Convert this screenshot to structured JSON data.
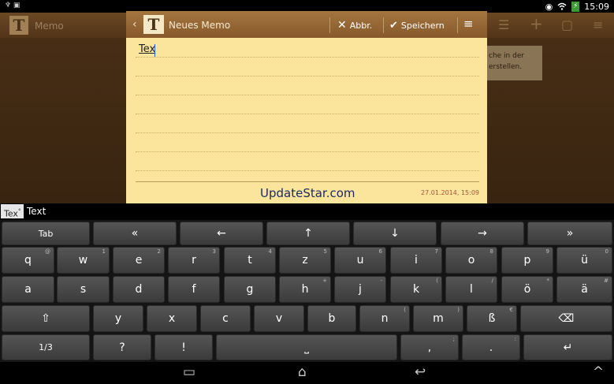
{
  "statusbar": {
    "left_icons": "♆ ▣",
    "eye": "◉",
    "wifi": "wifi",
    "battery": "⚡",
    "time": "15:09"
  },
  "bg": {
    "logo": "T",
    "title": "Memo",
    "hint_line1": "che in der",
    "hint_line2": "erstellen.",
    "icons": [
      "list-icon",
      "add-icon",
      "trash-icon",
      "menu-icon"
    ],
    "glyphs": {
      "list": "☰",
      "add": "+",
      "trash": "▢",
      "menu": "≡"
    }
  },
  "memo": {
    "back": "‹",
    "logo": "T",
    "title": "Neues Memo",
    "cancel_icon": "✕",
    "cancel": "Abbr.",
    "save_icon": "✔",
    "save": "Speichern",
    "menu_icon": "≡",
    "text": "Tex",
    "brand": "UpdateStar.com",
    "date": "27.01.2014,  15:09"
  },
  "suggestions": {
    "typed": "Tex",
    "suggestion": "Text",
    "typed_mark": "°"
  },
  "keyboard": {
    "row0": [
      {
        "l": "Tab"
      },
      {
        "l": "«"
      },
      {
        "l": "←"
      },
      {
        "l": "↑"
      },
      {
        "l": "↓"
      },
      {
        "l": "→"
      },
      {
        "l": "»"
      }
    ],
    "row1": [
      {
        "l": "q",
        "s": "@"
      },
      {
        "l": "w",
        "s": "1"
      },
      {
        "l": "e",
        "s": "2"
      },
      {
        "l": "r",
        "s": "3"
      },
      {
        "l": "t",
        "s": "4"
      },
      {
        "l": "z",
        "s": "5"
      },
      {
        "l": "u",
        "s": "6"
      },
      {
        "l": "i",
        "s": "7"
      },
      {
        "l": "o",
        "s": "8"
      },
      {
        "l": "p",
        "s": "9"
      },
      {
        "l": "ü",
        "s": "0"
      }
    ],
    "row2": [
      {
        "l": "a"
      },
      {
        "l": "s"
      },
      {
        "l": "d"
      },
      {
        "l": "f"
      },
      {
        "l": "g"
      },
      {
        "l": "h",
        "s": "+"
      },
      {
        "l": "j",
        "s": "-"
      },
      {
        "l": "k",
        "s": "("
      },
      {
        "l": "l",
        "s": "/"
      },
      {
        "l": "ö",
        "s": "*"
      },
      {
        "l": "ä",
        "s": "#"
      }
    ],
    "row3": [
      {
        "l": "⇧"
      },
      {
        "l": "y"
      },
      {
        "l": "x"
      },
      {
        "l": "c"
      },
      {
        "l": "v"
      },
      {
        "l": "b"
      },
      {
        "l": "n",
        "s": "("
      },
      {
        "l": "m",
        "s": ")"
      },
      {
        "l": "ß",
        "s": "€"
      },
      {
        "l": "⌫"
      }
    ],
    "row4": [
      {
        "l": "1/3"
      },
      {
        "l": "?"
      },
      {
        "l": "!"
      },
      {
        "l": "⎵"
      },
      {
        "l": ",",
        "s": ";"
      },
      {
        "l": ".",
        "s": ":"
      },
      {
        "l": "↵"
      }
    ]
  },
  "navbar": {
    "recent": "▭",
    "home": "⌂",
    "back": "↩",
    "collapse": "^"
  }
}
